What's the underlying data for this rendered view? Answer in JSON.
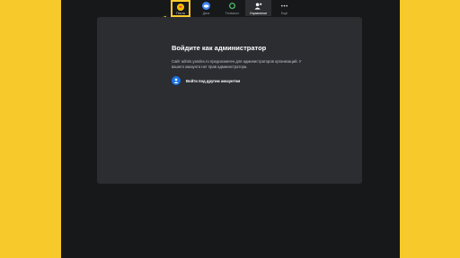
{
  "toolbar": {
    "items": [
      {
        "label": "Почта",
        "icon": "mail-icon",
        "color": "#f5c200"
      },
      {
        "label": "Диск",
        "icon": "disk-icon",
        "color": "#3a84f5"
      },
      {
        "label": "Телемост",
        "icon": "telemost-icon",
        "color": "#4cc26b"
      },
      {
        "label": "Управление",
        "icon": "admin-icon",
        "color": "#ffffff"
      },
      {
        "label": "Ещё",
        "icon": "more-icon",
        "color": "#ffffff"
      }
    ]
  },
  "dialog": {
    "title": "Войдите как администратор",
    "description": "Сайт admin.yandex.ru предназначен для администраторов организаций. У вашего аккаунта нет прав администратора.",
    "account_button": "Войти под другим аккаунтом"
  },
  "colors": {
    "background": "#f8c92b",
    "screen": "#17181a",
    "panel": "#2b2d31",
    "accent": "#1a73e8",
    "highlight": "#f8c92b"
  }
}
